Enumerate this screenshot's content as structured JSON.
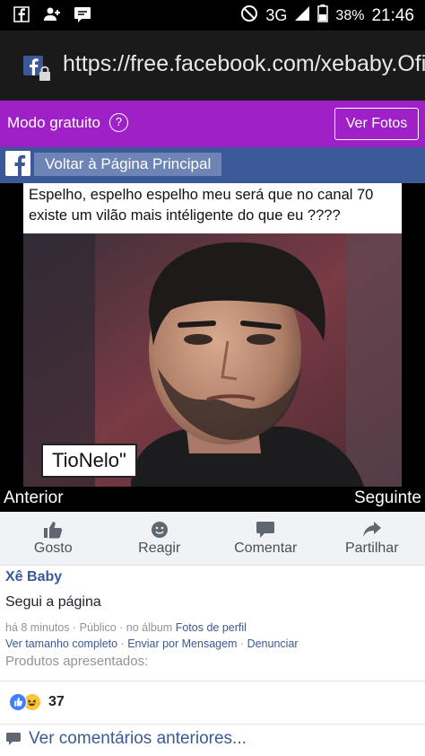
{
  "status_bar": {
    "network": "3G",
    "battery": "38%",
    "time": "21:46"
  },
  "url_bar": {
    "url": "https://free.facebook.com/xebaby.Ofi"
  },
  "free_mode": {
    "label": "Modo gratuito",
    "help": "?",
    "button": "Ver Fotos"
  },
  "back_bar": {
    "label": "Voltar à Página Principal"
  },
  "photo": {
    "caption": "Espelho, espelho espelho meu será que no canal 70 existe um vilão mais intéligente do que eu ????",
    "tag": "TioNelo\""
  },
  "photo_nav": {
    "prev": "Anterior",
    "next": "Seguinte"
  },
  "actions": [
    {
      "label": "Gosto",
      "icon": "thumbs-up-icon"
    },
    {
      "label": "Reagir",
      "icon": "smiley-icon"
    },
    {
      "label": "Comentar",
      "icon": "comment-icon"
    },
    {
      "label": "Partilhar",
      "icon": "share-icon"
    }
  ],
  "post": {
    "author": "Xê Baby",
    "text": "Segui a página",
    "meta_prefix": "há 8 minutos · Público · no álbum",
    "album": "Fotos de perfil",
    "links": [
      "Ver tamanho completo",
      "Enviar por Mensagem",
      "Denunciar"
    ],
    "products": "Produtos apresentados:",
    "reaction_count": "37",
    "previous_comments": "Ver comentários anteriores..."
  },
  "colors": {
    "free_bar": "#a020c8",
    "facebook_blue": "#3b5998",
    "link_blue": "#3b5998"
  }
}
